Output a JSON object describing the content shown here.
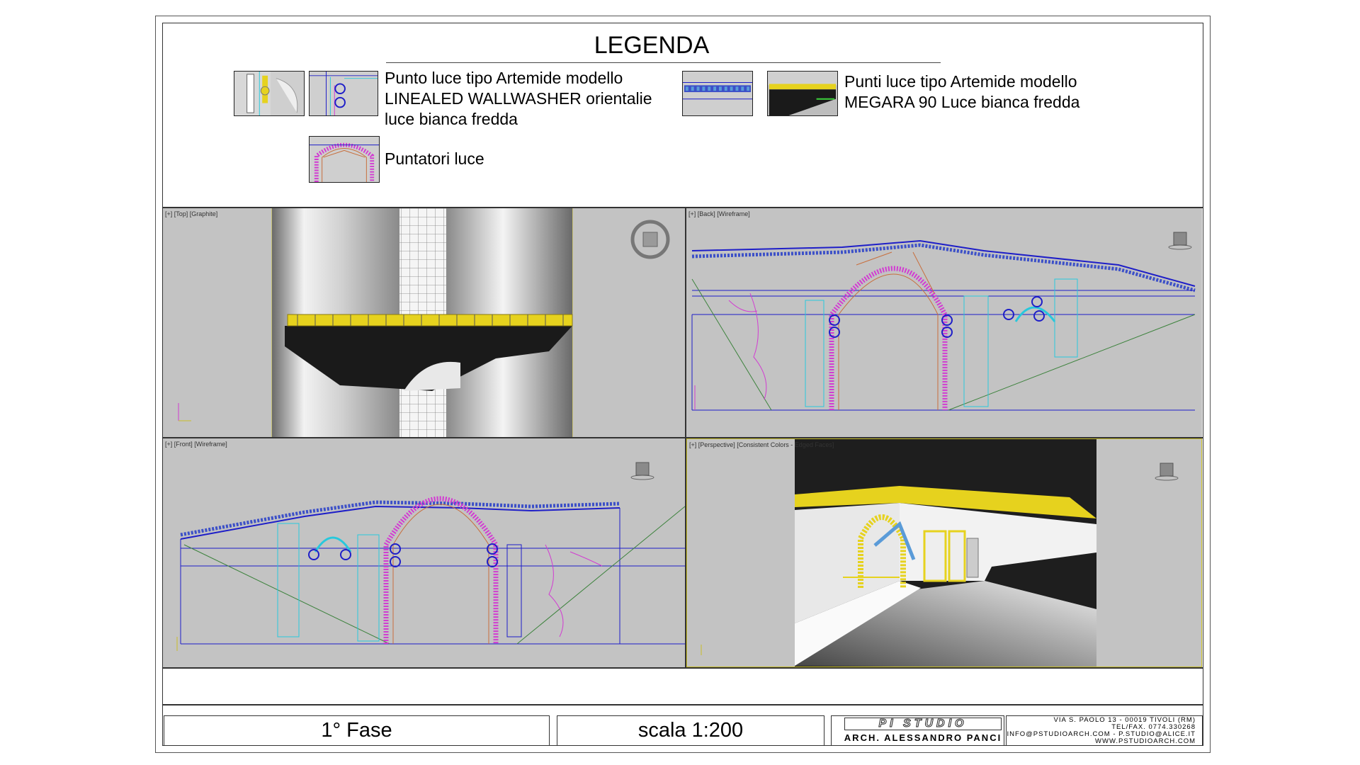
{
  "legend": {
    "title": "LEGENDA",
    "items": [
      {
        "text_lines": [
          "Punto luce tipo Artemide modello",
          "LINEALED WALLWASHER orientalie",
          "luce bianca fredda"
        ]
      },
      {
        "text_lines": [
          "Punti luce tipo Artemide modello",
          "MEGARA 90 Luce bianca fredda"
        ]
      },
      {
        "text_lines": [
          "Puntatori luce"
        ]
      }
    ]
  },
  "viewports": [
    {
      "label": "[+] [Top] [Graphite]"
    },
    {
      "label": "[+] [Back] [Wireframe]"
    },
    {
      "label": "[+] [Front] [Wireframe]"
    },
    {
      "label": "[+] [Perspective] [Consistent Colors - Edged Faces]"
    }
  ],
  "title_block": {
    "phase": "1° Fase",
    "scale": "scala 1:200",
    "studio_name": "PI STUDIO",
    "architect": "ARCH. ALESSANDRO PANCI",
    "address_lines": [
      "VIA S. PAOLO 13 - 00019 TIVOLI (RM)",
      "TEL/FAX. 0774.330268",
      "INFO@PSTUDIOARCH.COM - P.STUDIO@ALICE.IT",
      "WWW.PSTUDIOARCH.COM"
    ]
  },
  "colors": {
    "viewport_bg": "#c3c3c3",
    "wire_blue": "#1e1ec8",
    "wire_cyan": "#28c8dc",
    "wire_magenta": "#d23cd2",
    "light_yellow": "#e6d21e",
    "rust": "#c86e3c",
    "persp_bg": "#1e1e1e"
  }
}
